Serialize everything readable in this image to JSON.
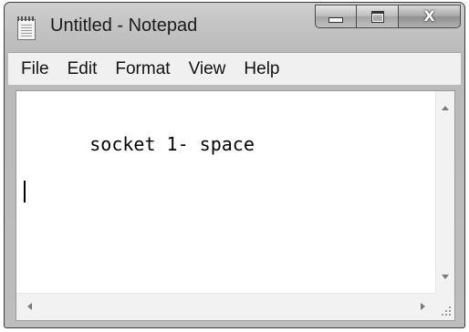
{
  "window": {
    "title": "Untitled - Notepad",
    "icon": "notepad-icon"
  },
  "caption_buttons": {
    "minimize": "minimize-icon",
    "maximize": "maximize-icon",
    "close": "close-icon",
    "close_glyph": "X"
  },
  "menubar": {
    "items": [
      {
        "label": "File"
      },
      {
        "label": "Edit"
      },
      {
        "label": "Format"
      },
      {
        "label": "View"
      },
      {
        "label": "Help"
      }
    ]
  },
  "editor": {
    "content": "socket 1- space"
  },
  "colors": {
    "window_frame": "#c2c2c2",
    "menubar": "#f0f0f0",
    "editor_background": "#ffffff"
  }
}
